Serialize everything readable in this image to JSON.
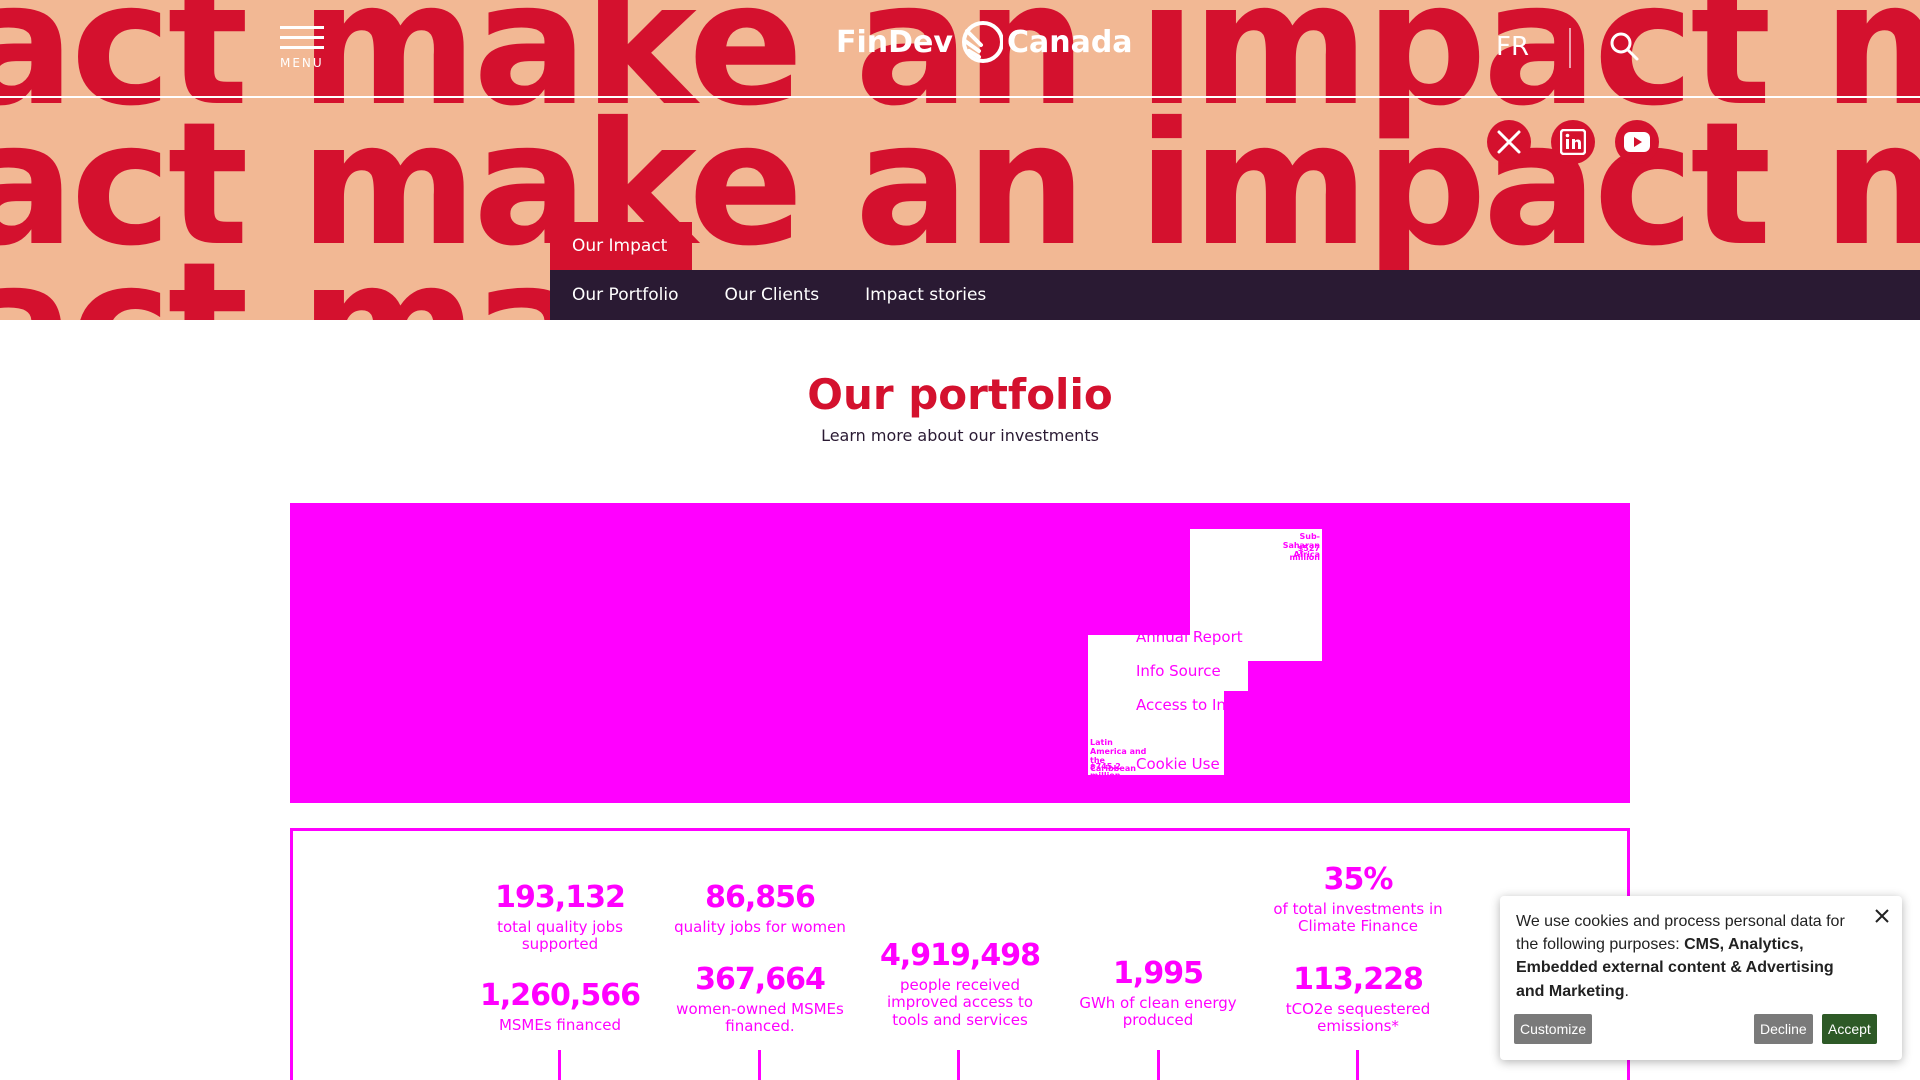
{
  "hero": {
    "background_color": "#f2b894",
    "word_color": "#d4112e",
    "rows": [
      "act make an impact make",
      "act make an impact mak",
      "act ma"
    ]
  },
  "header": {
    "menu_label": "MENU",
    "logo_text_left": "FinDev",
    "logo_text_right": "Canada",
    "language_toggle": "FR",
    "search_icon": "search-icon",
    "social": [
      "x-icon",
      "linkedin-icon",
      "youtube-icon"
    ]
  },
  "section_tab": "Our Impact",
  "subnav": [
    "Our Portfolio",
    "Our Clients",
    "Impact stories"
  ],
  "main": {
    "title": "Our portfolio",
    "subtitle": "Learn more about our investments"
  },
  "map_panel": {
    "background_color": "#ff00ff",
    "region_labels": [
      {
        "name": "Sub-Saharan Africa",
        "amount": "$527 million"
      },
      {
        "name": "Latin America and the Caribbean",
        "amount": "$745.2 million"
      }
    ],
    "overlay_links": [
      "Annual Report",
      "Info Source",
      "Access to Information",
      "Cookie Use"
    ]
  },
  "stats": [
    {
      "value": "193,132",
      "label": "total quality jobs supported"
    },
    {
      "value": "1,260,566",
      "label": "MSMEs financed"
    },
    {
      "value": "86,856",
      "label": "quality jobs for women"
    },
    {
      "value": "367,664",
      "label": "women-owned MSMEs financed."
    },
    {
      "value": "4,919,498",
      "label": "people received improved access to tools and services"
    },
    {
      "value": "1,995",
      "label": "GWh of clean energy produced"
    },
    {
      "value": "35%",
      "label": "of total investments in Climate Finance"
    },
    {
      "value": "113,228",
      "label": "tCO2e sequestered emissions*"
    }
  ],
  "cookie": {
    "text_intro": "We use cookies and process personal data for the following purposes: ",
    "text_purposes": "CMS, Analytics, Embedded external content & Advertising and Marketing",
    "text_end": ".",
    "customize": "Customize",
    "decline": "Decline",
    "accept": "Accept"
  }
}
